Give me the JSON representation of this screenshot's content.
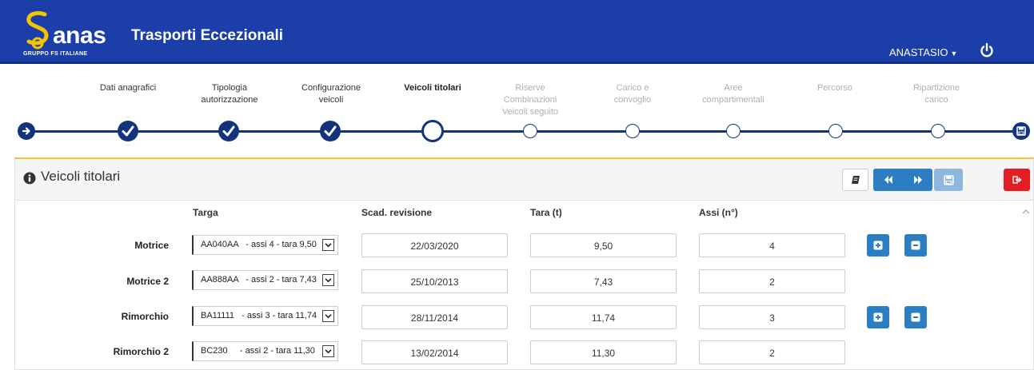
{
  "header": {
    "brand": "anas",
    "brand_sub": "GRUPPO FS ITALIANE",
    "title": "Trasporti Eccezionali",
    "user": "ANASTASIO"
  },
  "wizard": {
    "steps": [
      {
        "label": "Dati anagrafici",
        "state": "done"
      },
      {
        "label": "Tipologia autorizzazione",
        "state": "done"
      },
      {
        "label": "Configurazione veicoli",
        "state": "done"
      },
      {
        "label": "Veicoli titolari",
        "state": "current"
      },
      {
        "label": "Riserve Combinazioni Veicoli seguito",
        "state": "todo"
      },
      {
        "label": "Carico e convoglio",
        "state": "todo"
      },
      {
        "label": "Aree compartimentali",
        "state": "todo"
      },
      {
        "label": "Percorso",
        "state": "todo"
      },
      {
        "label": "Ripartizione carico",
        "state": "todo"
      }
    ]
  },
  "panel": {
    "title": "Veicoli titolari",
    "columns": [
      "Targa",
      "Scad. revisione",
      "Tara (t)",
      "Assi (n°)"
    ],
    "rows": [
      {
        "label": "Motrice",
        "targa": "AA040AA   - assi 4 - tara 9,50",
        "scadenza": "22/03/2020",
        "tara": "9,50",
        "assi": "4",
        "actions": true
      },
      {
        "label": "Motrice 2",
        "targa": "AA888AA   - assi 2 - tara 7,43",
        "scadenza": "25/10/2013",
        "tara": "7,43",
        "assi": "2",
        "actions": false
      },
      {
        "label": "Rimorchio",
        "targa": "BA11111   - assi 3 - tara 11,74",
        "scadenza": "28/11/2014",
        "tara": "11,74",
        "assi": "3",
        "actions": true
      },
      {
        "label": "Rimorchio 2",
        "targa": "BC230     - assi 2 - tara 11,30",
        "scadenza": "13/02/2014",
        "tara": "11,30",
        "assi": "2",
        "actions": false
      }
    ]
  },
  "colors": {
    "header_bg": "#1b3ea8",
    "wizard_dark": "#13337d",
    "accent_blue": "#2b7ec2",
    "exit_red": "#e41c23",
    "panel_border_top": "#f2c531",
    "logo_yellow": "#f5c400"
  },
  "icons": [
    "anas-s-logo",
    "power-icon",
    "arrow-right-icon",
    "check-icon",
    "save-icon",
    "info-icon",
    "book-icon",
    "backward-icon",
    "forward-icon",
    "exit-icon",
    "plus-icon",
    "minus-icon",
    "chevron-up-icon"
  ]
}
